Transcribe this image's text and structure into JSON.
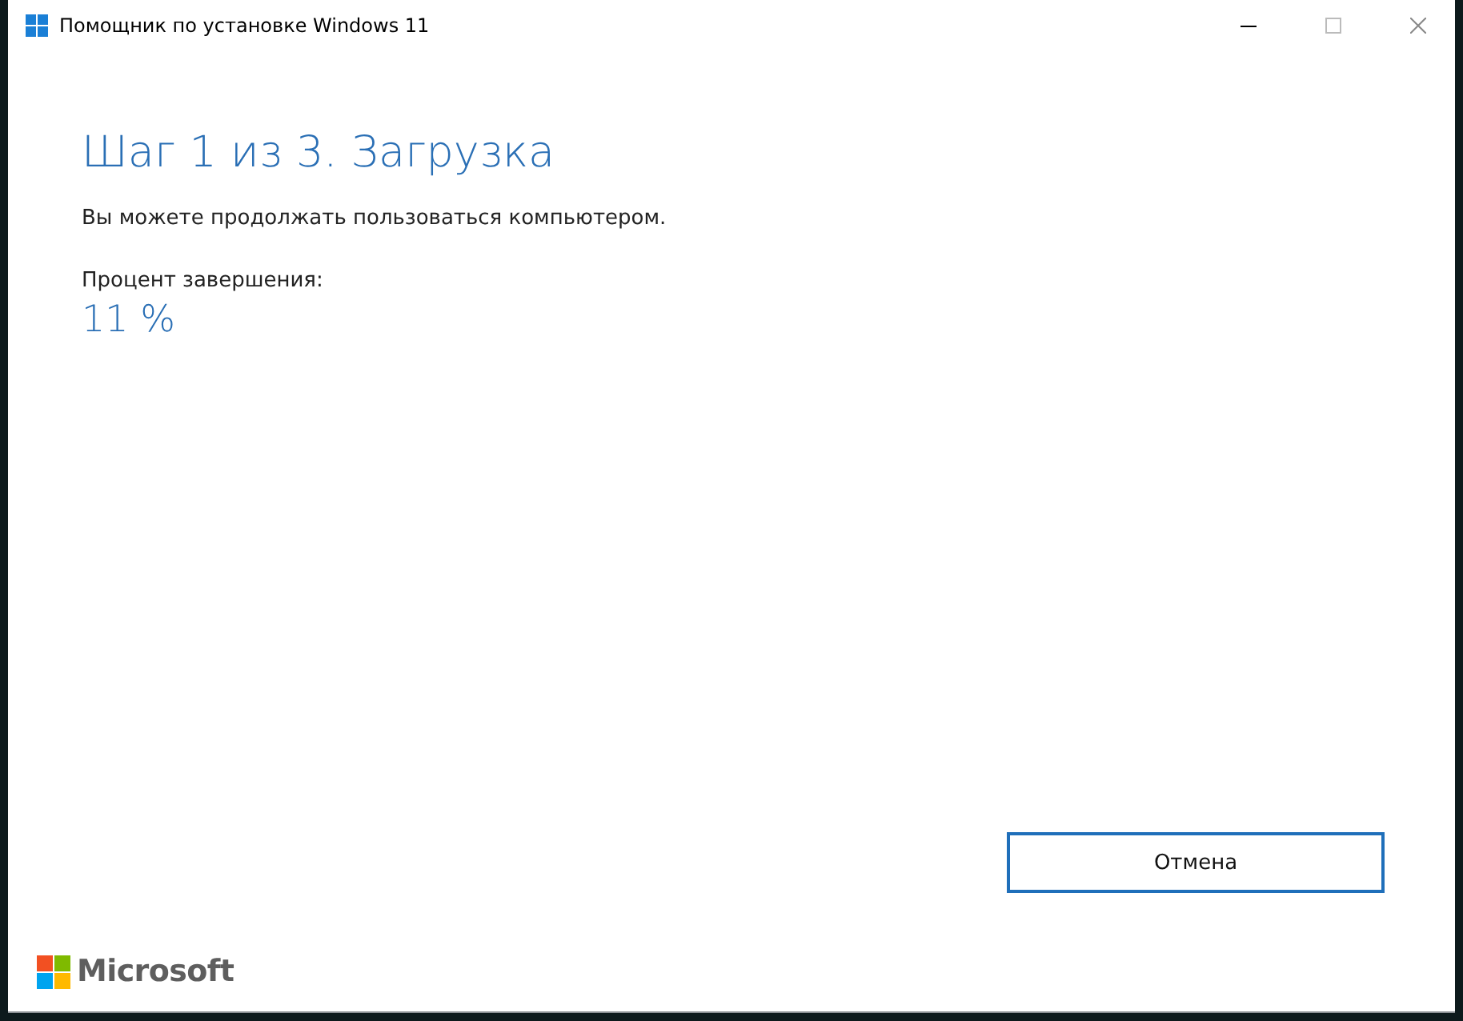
{
  "window": {
    "title": "Помощник по установке Windows 11"
  },
  "heading": "Шаг 1 из 3. Загрузка",
  "description": "Вы можете продолжать пользоваться компьютером.",
  "progress": {
    "label": "Процент завершения:",
    "value": "11 %"
  },
  "buttons": [
    "Отмена"
  ],
  "footer": {
    "brand": "Microsoft"
  }
}
